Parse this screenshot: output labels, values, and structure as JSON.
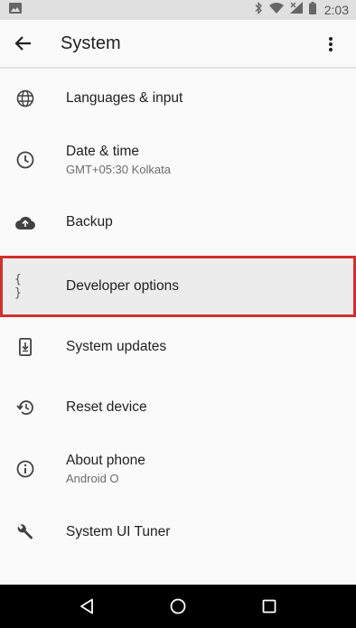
{
  "status_bar": {
    "time": "2:03",
    "icons": [
      "image-notification-icon",
      "bluetooth-icon",
      "wifi-icon",
      "cellular-signal-icon",
      "battery-icon"
    ]
  },
  "app_bar": {
    "title": "System",
    "back_icon": "arrow-back-icon",
    "overflow_icon": "more-vert-icon"
  },
  "items": [
    {
      "title": "Languages & input",
      "summary": "",
      "icon": "globe-icon"
    },
    {
      "title": "Date & time",
      "summary": "GMT+05:30 Kolkata",
      "icon": "clock-icon"
    },
    {
      "title": "Backup",
      "summary": "",
      "icon": "cloud-upload-icon"
    },
    {
      "title": "Developer options",
      "summary": "",
      "icon": "braces-icon",
      "highlighted": true
    },
    {
      "title": "System updates",
      "summary": "",
      "icon": "system-update-icon"
    },
    {
      "title": "Reset device",
      "summary": "",
      "icon": "restore-icon"
    },
    {
      "title": "About phone",
      "summary": "Android O",
      "icon": "info-icon"
    },
    {
      "title": "System UI Tuner",
      "summary": "",
      "icon": "wrench-icon"
    }
  ],
  "braces_glyph": "{ }",
  "nav_bar": {
    "icons": [
      "back-triangle-icon",
      "home-circle-icon",
      "recents-square-icon"
    ]
  },
  "colors": {
    "highlight_border": "#d32f2f",
    "nav_bar": "#000000",
    "status_bar": "#e0e0e0"
  }
}
